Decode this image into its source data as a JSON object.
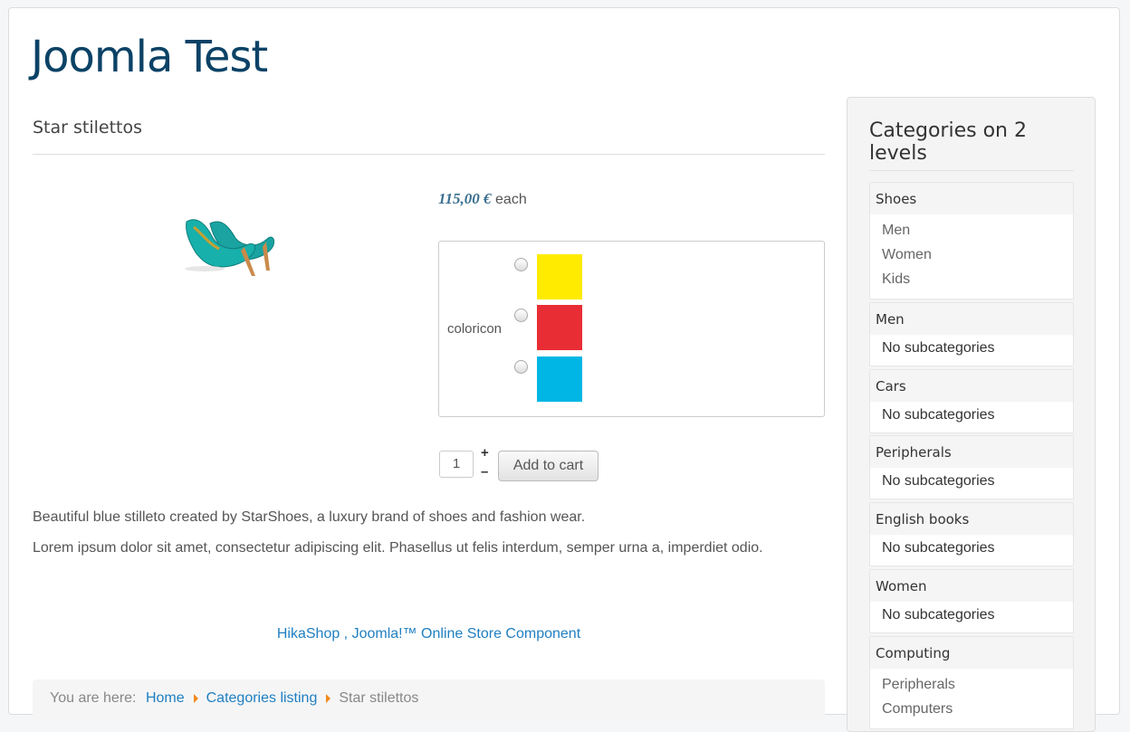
{
  "site": {
    "title": "Joomla Test"
  },
  "product": {
    "name": "Star stilettos",
    "price": "115,00 €",
    "price_unit": "each",
    "option_label": "coloricon",
    "colors": [
      "#ffeb00",
      "#e82e34",
      "#00b6e5"
    ],
    "quantity": "1",
    "plus": "+",
    "minus": "–",
    "add_to_cart": "Add to cart",
    "description": [
      "Beautiful blue stilleto created by StarShoes, a luxury brand of shoes and fashion wear.",
      "Lorem ipsum dolor sit amet, consectetur adipiscing elit. Phasellus ut felis interdum, semper urna a, imperdiet odio."
    ]
  },
  "footer": {
    "link": "HikaShop , Joomla!™ Online Store Component"
  },
  "breadcrumb": {
    "prefix": "You are here:",
    "items": [
      "Home",
      "Categories listing"
    ],
    "current": "Star stilettos"
  },
  "sidebar": {
    "title": "Categories on 2 levels",
    "categories": [
      {
        "name": "Shoes",
        "subs": [
          "Men",
          "Women",
          "Kids"
        ]
      },
      {
        "name": "Men",
        "empty": "No subcategories"
      },
      {
        "name": "Cars",
        "empty": "No subcategories"
      },
      {
        "name": "Peripherals",
        "empty": "No subcategories"
      },
      {
        "name": "English books",
        "empty": "No subcategories"
      },
      {
        "name": "Women",
        "empty": "No subcategories"
      },
      {
        "name": "Computing",
        "subs": [
          "Peripherals",
          "Computers"
        ]
      }
    ]
  }
}
